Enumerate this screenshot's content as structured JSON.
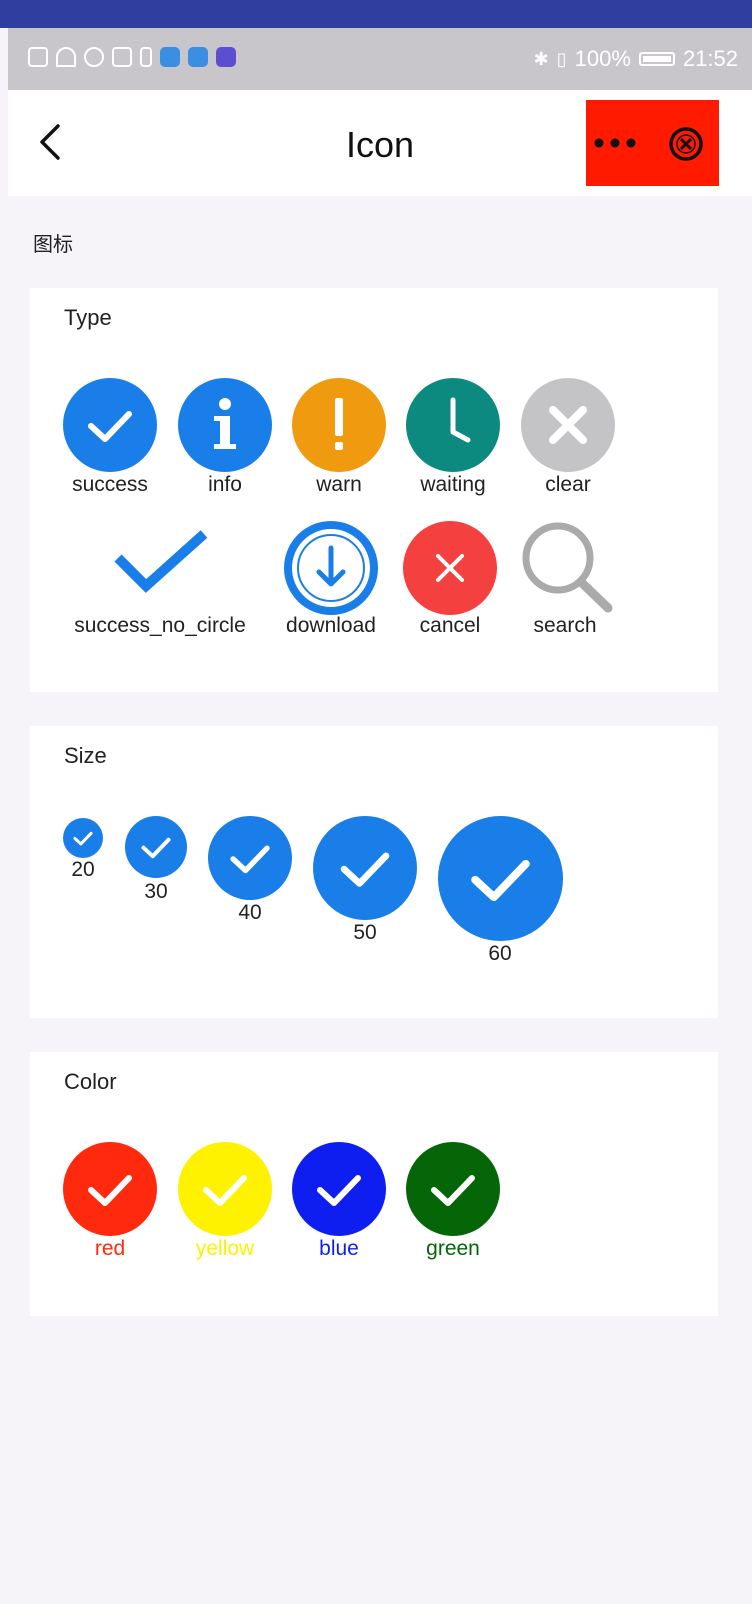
{
  "status_bar": {
    "battery": "100%",
    "time": "21:52"
  },
  "nav": {
    "title": "Icon"
  },
  "page": {
    "heading": "图标"
  },
  "type_section": {
    "title": "Type",
    "items": [
      {
        "label": "success",
        "icon": "success-icon",
        "color": "#1a7ee8"
      },
      {
        "label": "info",
        "icon": "info-icon",
        "color": "#1a7ee8"
      },
      {
        "label": "warn",
        "icon": "warn-icon",
        "color": "#f09a10"
      },
      {
        "label": "waiting",
        "icon": "waiting-icon",
        "color": "#0d8a80"
      },
      {
        "label": "clear",
        "icon": "clear-icon",
        "color": "#c4c3c5"
      },
      {
        "label": "success_no_circle",
        "icon": "success-no-circle-icon",
        "color": "#1a7ee8"
      },
      {
        "label": "download",
        "icon": "download-icon",
        "color": "#1a7ee8"
      },
      {
        "label": "cancel",
        "icon": "cancel-icon",
        "color": "#f54040"
      },
      {
        "label": "search",
        "icon": "search-icon",
        "color": "#aaaaaa"
      }
    ]
  },
  "size_section": {
    "title": "Size",
    "items": [
      {
        "label": "20"
      },
      {
        "label": "30"
      },
      {
        "label": "40"
      },
      {
        "label": "50"
      },
      {
        "label": "60"
      }
    ]
  },
  "color_section": {
    "title": "Color",
    "items": [
      {
        "label": "red",
        "color": "#ff2a0e"
      },
      {
        "label": "yellow",
        "color": "#fff200"
      },
      {
        "label": "blue",
        "color": "#0f1ef0"
      },
      {
        "label": "green",
        "color": "#056608"
      }
    ]
  }
}
